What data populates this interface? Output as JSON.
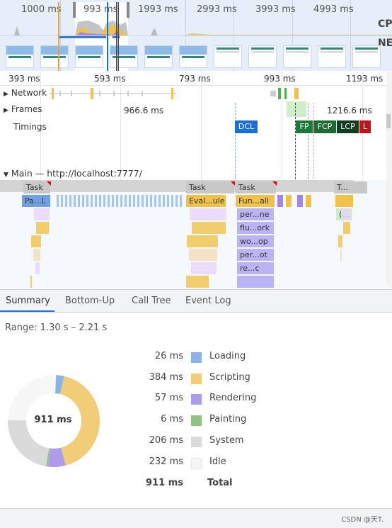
{
  "overview": {
    "time_labels": [
      "1000 ms",
      "993 ms",
      "1993 ms",
      "2993 ms",
      "3993 ms",
      "4993 ms"
    ],
    "cpu_label": "CPU",
    "net_label": "NET"
  },
  "ruler": {
    "labels": [
      "393 ms",
      "593 ms",
      "793 ms",
      "993 ms",
      "1193 ms"
    ]
  },
  "tracks": {
    "network": "Network",
    "frames": "Frames",
    "frame_time_1": "966.6 ms",
    "frame_time_2": "1216.6 ms",
    "timings": "Timings",
    "main": "Main — http://localhost:7777/"
  },
  "timing_markers": [
    {
      "label": "DCL",
      "color": "#1a6ed8"
    },
    {
      "label": "FP",
      "color": "#1e7a3a"
    },
    {
      "label": "FCP",
      "color": "#1e6a32"
    },
    {
      "label": "LCP",
      "color": "#143d22"
    },
    {
      "label": "L",
      "color": "#c0141a"
    }
  ],
  "flame": {
    "tasks": [
      "Task",
      "Task",
      "Task",
      "T..."
    ],
    "row2": [
      "Pa...L",
      "Eval...ule",
      "Fun...all"
    ],
    "stack": [
      "per...ne",
      "flu...ork",
      "wo...op",
      "per...ot",
      "re...c"
    ],
    "other": "(..."
  },
  "tabs": [
    {
      "label": "Summary",
      "active": true
    },
    {
      "label": "Bottom-Up",
      "active": false
    },
    {
      "label": "Call Tree",
      "active": false
    },
    {
      "label": "Event Log",
      "active": false
    }
  ],
  "summary": {
    "range": "Range: 1.30 s – 2.21 s",
    "total_center": "911 ms",
    "categories": [
      {
        "value": "26 ms",
        "ms": 26,
        "label": "Loading",
        "color": "#8ab4e8"
      },
      {
        "value": "384 ms",
        "ms": 384,
        "label": "Scripting",
        "color": "#f2cd78"
      },
      {
        "value": "57 ms",
        "ms": 57,
        "label": "Rendering",
        "color": "#af9beb"
      },
      {
        "value": "6 ms",
        "ms": 6,
        "label": "Painting",
        "color": "#8fc483"
      },
      {
        "value": "206 ms",
        "ms": 206,
        "label": "System",
        "color": "#dadada"
      },
      {
        "value": "232 ms",
        "ms": 232,
        "label": "Idle",
        "color": "#f7f7f7"
      }
    ],
    "total_value": "911 ms",
    "total_label": "Total"
  },
  "footer": {
    "watermark": "CSDN @天T."
  }
}
